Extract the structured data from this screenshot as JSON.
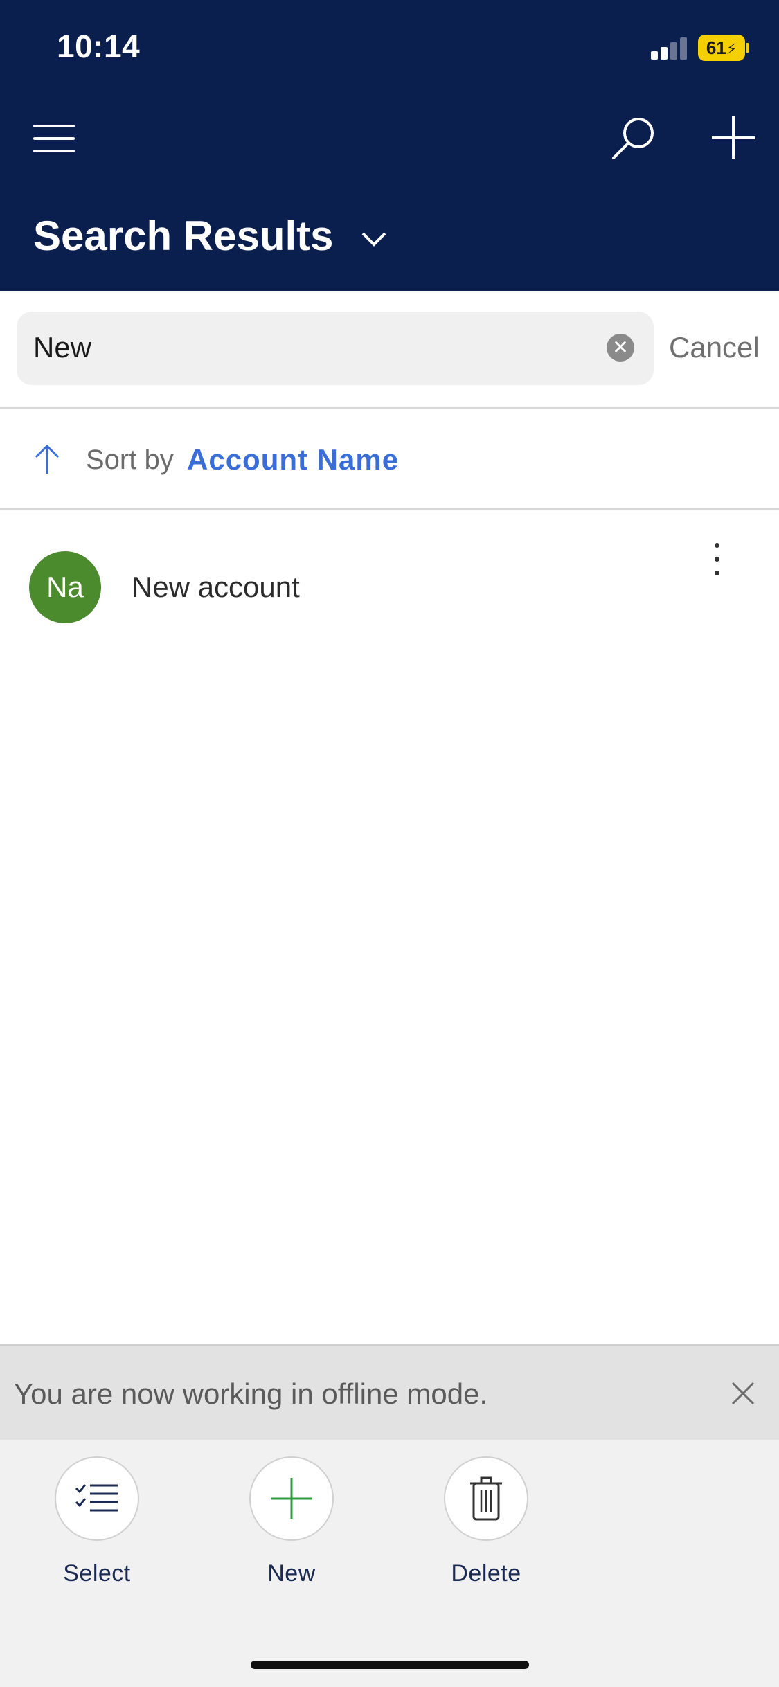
{
  "status_bar": {
    "time": "10:14",
    "battery": "61"
  },
  "header": {
    "title": "Search Results",
    "icons": [
      "hamburger-menu-icon",
      "search-icon",
      "plus-icon",
      "chevron-down-icon"
    ]
  },
  "search": {
    "value": "New",
    "cancel_label": "Cancel"
  },
  "sort": {
    "label": "Sort by",
    "field": "Account Name",
    "direction": "ascending"
  },
  "results": [
    {
      "initials": "Na",
      "name": "New account",
      "avatar_color": "#4c8a2e"
    }
  ],
  "banner": {
    "message": "You are now working in offline mode."
  },
  "commands": [
    {
      "label": "Select",
      "icon": "checklist-icon"
    },
    {
      "label": "New",
      "icon": "plus-icon"
    },
    {
      "label": "Delete",
      "icon": "trash-icon"
    }
  ],
  "colors": {
    "header_bg": "#0b1f4f",
    "accent": "#3a6ed6",
    "new_green": "#2e9b3e",
    "battery": "#f5d000"
  }
}
